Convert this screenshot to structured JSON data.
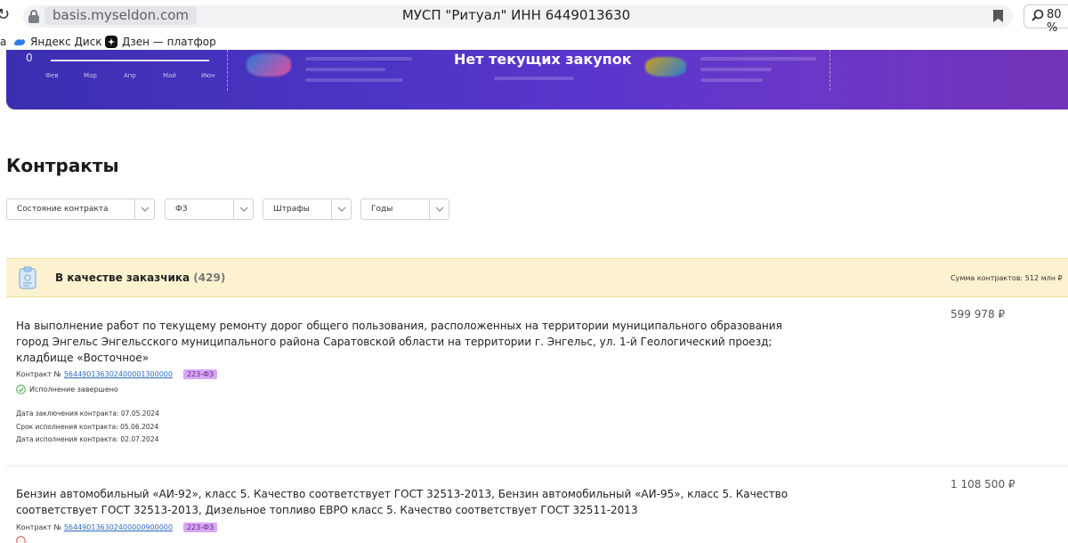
{
  "browser": {
    "url_domain": "basis.myseldon.com",
    "tab_title": "МУСП \"Ритуал\" ИНН 6449013630",
    "zoom": "80 %",
    "bookmarks": [
      {
        "label": "Яндекс Диск",
        "icon": "yandex-disk-icon"
      },
      {
        "label": "Дзен — платформа",
        "icon": "dzen-icon"
      }
    ],
    "bookmark_cut_char": "а"
  },
  "banner": {
    "headline": "Нет текущих закупок",
    "chart_zero": "0",
    "months": [
      "Фев",
      "Мар",
      "Апр",
      "Май",
      "Июн"
    ]
  },
  "contracts": {
    "title": "Контракты",
    "filters": [
      {
        "label": "Состояние контракта"
      },
      {
        "label": "ФЗ"
      },
      {
        "label": "Штрафы"
      },
      {
        "label": "Годы"
      }
    ],
    "group": {
      "title": "В качестве заказчика",
      "count": "(429)",
      "sum": "Сумма контрактов: 512 млн ₽"
    },
    "items": [
      {
        "title": "На выполнение работ по текущему ремонту дорог общего пользования, расположенных на территории муниципального образования город Энгельс Энгельсского муниципального района Саратовской области на территории г. Энгельс, ул. 1-й Геологический проезд; кладбище «Восточное»",
        "price": "599 978 ₽",
        "number_label": "Контракт №",
        "number": "564490136302400001300000",
        "law": "223-ФЗ",
        "status": "Исполнение завершено",
        "dates": [
          "Дата заключения контракта: 07.05.2024",
          "Срок исполнения контракта: 05.06.2024",
          "Дата исполнения контракта: 02.07.2024"
        ]
      },
      {
        "title": "Бензин автомобильный «АИ-92», класс 5. Качество соответствует ГОСТ 32513-2013, Бензин автомобильный «АИ-95», класс 5. Качество соответствует ГОСТ 32513-2013, Дизельное топливо ЕВРО класс 5. Качество соответствует ГОСТ 32511-2013",
        "price": "1 108 500 ₽",
        "number_label": "Контракт №",
        "number": "564490136302400000900000",
        "law": "223-ФЗ"
      }
    ]
  },
  "colors": {
    "banner_start": "#3b2fb0",
    "banner_end": "#7334b8",
    "group_bg": "#fdf2cf",
    "link": "#2a6bbf",
    "law_badge": "#d9a6f2",
    "status_ok": "#4caf50"
  }
}
